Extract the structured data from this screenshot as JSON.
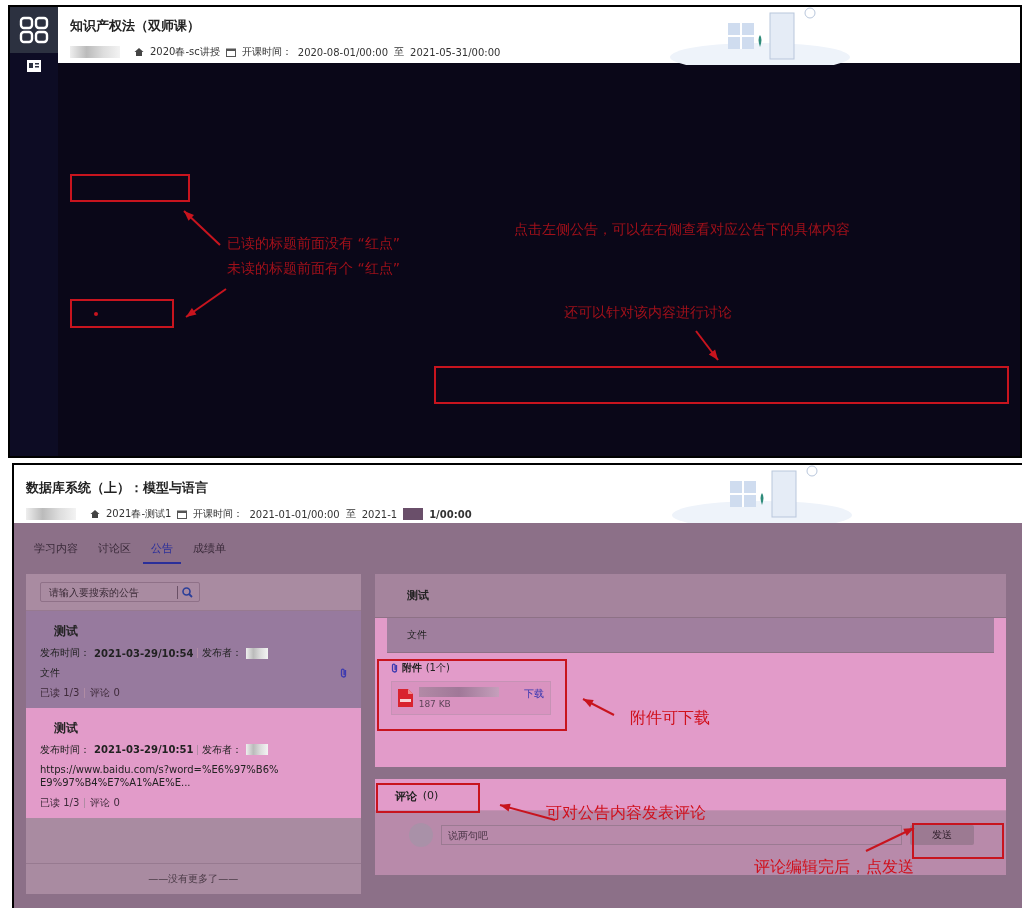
{
  "top_screen": {
    "course_title": "知识产权法（双师课）",
    "term": "2020春-sc讲授",
    "time_label": "开课时间：",
    "start": "2020-08-01/00:00",
    "to": "至",
    "end": "2021-05-31/00:00",
    "annotations": [
      {
        "text": "已读的标题前面没有 “红点”"
      },
      {
        "text": "未读的标题前面有个 “红点”"
      },
      {
        "text": "点击左侧公告，可以在右侧查看对应公告下的具体内容"
      },
      {
        "text": "还可以针对该内容进行讨论"
      }
    ]
  },
  "bottom_screen": {
    "course_title": "数据库系统（上）：模型与语言",
    "term": "2021春-测试1",
    "time_label": "开课时间：",
    "start": "2021-01-01/00:00",
    "to": "至",
    "end_head": "2021-1",
    "end_tail": "1/00:00",
    "tabs": [
      {
        "label": "学习内容",
        "selected": false
      },
      {
        "label": "讨论区",
        "selected": false
      },
      {
        "label": "公告",
        "selected": true
      },
      {
        "label": "成绩单",
        "selected": false
      }
    ],
    "search": {
      "placeholder": "请输入要搜索的公告"
    },
    "announcements": [
      {
        "title": "测试",
        "time_label": "发布时间：",
        "time": "2021-03-29/10:54",
        "publisher_label": "发布者：",
        "body": "文件",
        "attachment": true,
        "read": "已读 1/3",
        "comments": "评论 0",
        "selected": true
      },
      {
        "title": "测试",
        "time_label": "发布时间：",
        "time": "2021-03-29/10:51",
        "publisher_label": "发布者：",
        "body": "https://www.baidu.com/s?word=%E6%97%B6%E9%97%B4%E7%A1%AE%E...",
        "attachment": false,
        "read": "已读 1/3",
        "comments": "评论 0",
        "selected": false
      }
    ],
    "list_end": "——没有更多了——",
    "detail": {
      "title": "测试",
      "body": "文件",
      "attachments_label": "附件",
      "attachments_count": "(1个)",
      "file_size": "187 KB",
      "download": "下载"
    },
    "comments": {
      "label": "评论",
      "count": "(0)",
      "placeholder": "说两句吧",
      "send": "发送"
    },
    "annotations": [
      {
        "text": "附件可下载"
      },
      {
        "text": "可对公告内容发表评论"
      },
      {
        "text": "评论编辑完后，点发送"
      }
    ]
  }
}
